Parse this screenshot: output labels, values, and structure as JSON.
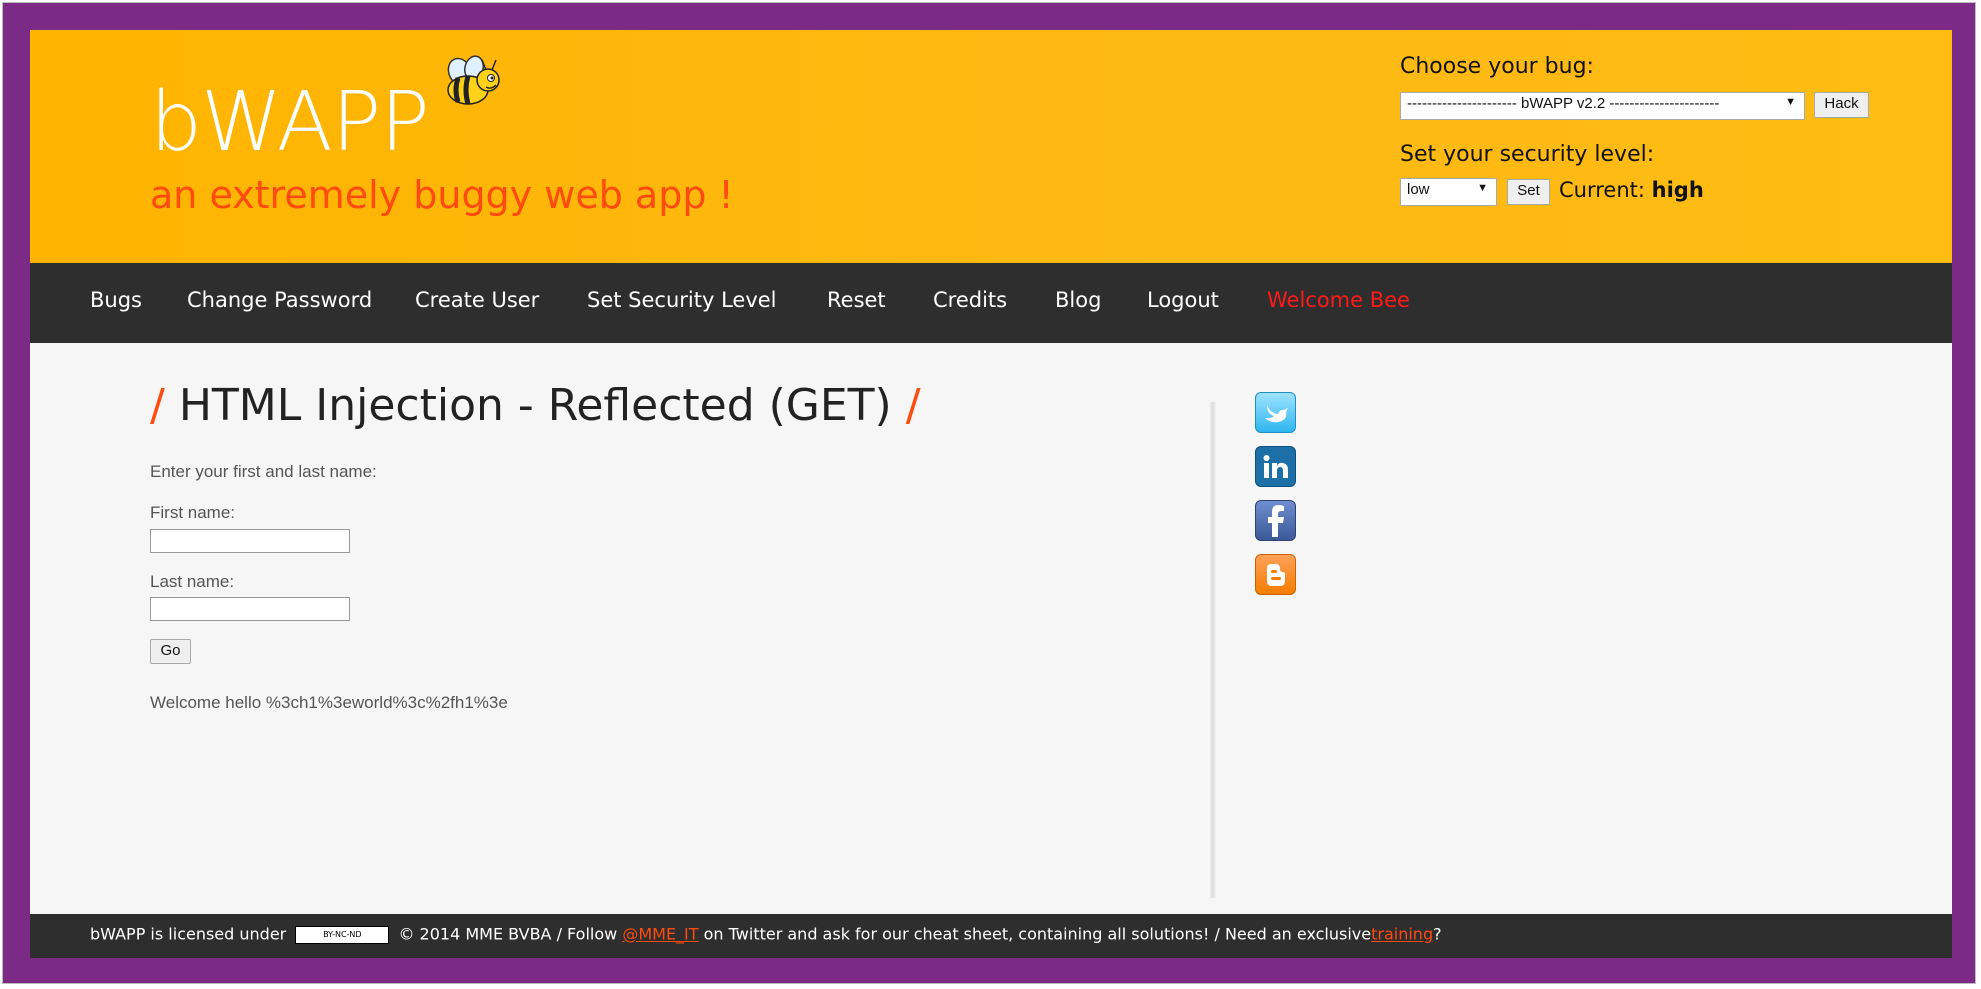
{
  "header": {
    "logo": "bWAPP",
    "tagline": "an extremely buggy web app !",
    "choose_bug_label": "Choose your bug:",
    "bug_select_value": "---------------------- bWAPP v2.2 ----------------------",
    "hack_button": "Hack",
    "security_label": "Set your security level:",
    "security_select_value": "low",
    "set_button": "Set",
    "current_label": "Current:",
    "current_value": "high"
  },
  "nav": {
    "items": [
      {
        "label": "Bugs"
      },
      {
        "label": "Change Password"
      },
      {
        "label": "Create User"
      },
      {
        "label": "Set Security Level"
      },
      {
        "label": "Reset"
      },
      {
        "label": "Credits"
      },
      {
        "label": "Blog"
      },
      {
        "label": "Logout"
      },
      {
        "label": "Welcome Bee"
      }
    ]
  },
  "main": {
    "title_slash_left": "/",
    "title": "HTML Injection - Reflected (GET)",
    "title_slash_right": "/",
    "intro": "Enter your first and last name:",
    "first_name_label": "First name:",
    "first_name_value": "",
    "last_name_label": "Last name:",
    "last_name_value": "",
    "go_button": "Go",
    "result": "Welcome hello %3ch1%3eworld%3c%2fh1%3e"
  },
  "social": [
    "twitter-icon",
    "linkedin-icon",
    "facebook-icon",
    "blogger-icon"
  ],
  "footer": {
    "text_1": "bWAPP is licensed under",
    "cc_badge": "BY-NC-ND",
    "text_2": "© 2014 MME BVBA / Follow",
    "twitter_link": "@MME_IT",
    "text_3": "on Twitter and ask for our cheat sheet, containing all solutions! / Need an exclusive",
    "training_link": "training",
    "text_4": "?"
  },
  "colors": {
    "frame": "#7b2a86",
    "header_bg": "#ffb400",
    "accent": "#ff4a10",
    "nav_bg": "#2e2e2e",
    "welcome": "#ff1a1a"
  }
}
